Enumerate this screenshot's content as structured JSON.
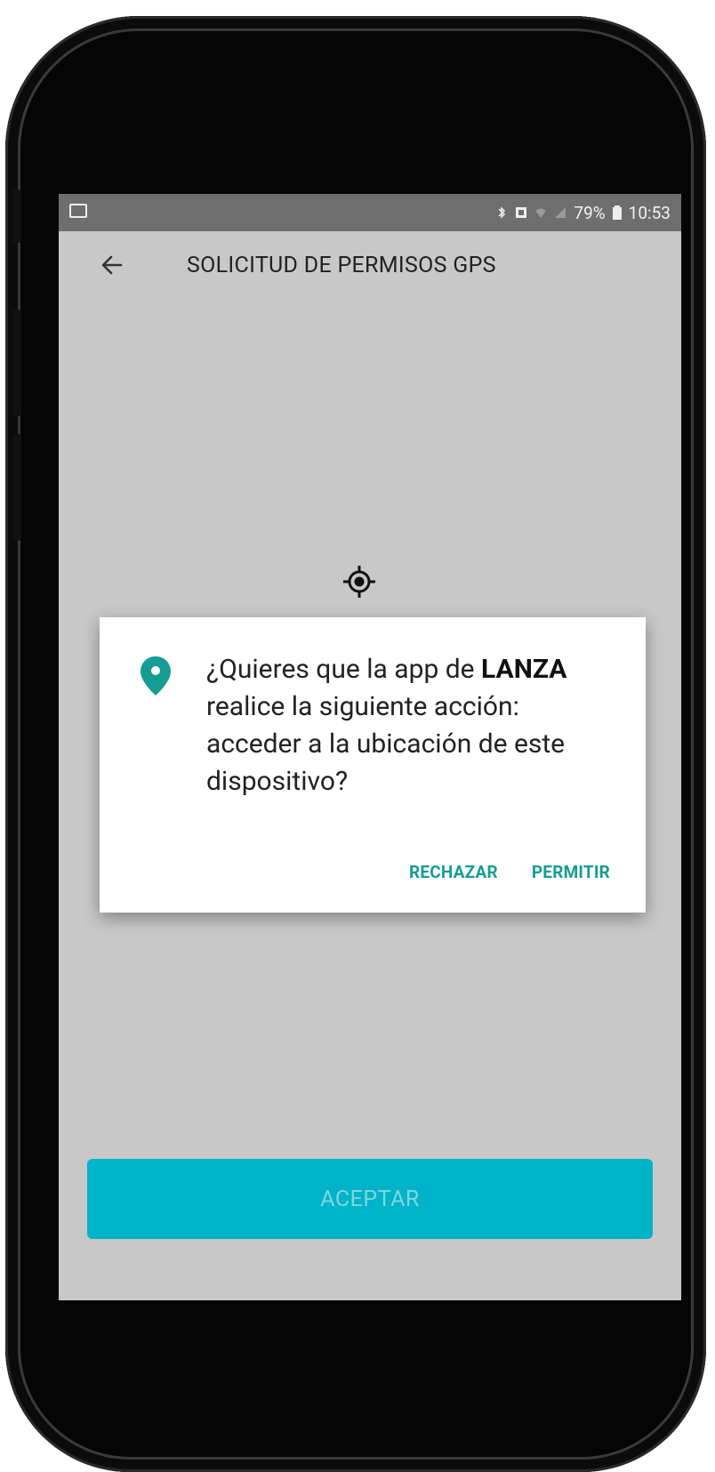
{
  "status_bar": {
    "battery": "79%",
    "time": "10:53"
  },
  "app_bar": {
    "title": "SOLICITUD DE PERMISOS GPS"
  },
  "dialog": {
    "message_pre": "¿Quieres que la app de ",
    "app_name": "LANZA",
    "message_post": " realice la siguiente acción: acceder a la ubicación de este dispositivo?",
    "deny_label": "RECHAZAR",
    "allow_label": "PERMITIR",
    "accent_color": "#159d94"
  },
  "accept_button": {
    "label": "ACEPTAR",
    "color": "#00b3c8"
  },
  "icons": {
    "back": "arrow-left-icon",
    "location_target": "gps-target-icon",
    "pin": "location-pin-icon"
  }
}
